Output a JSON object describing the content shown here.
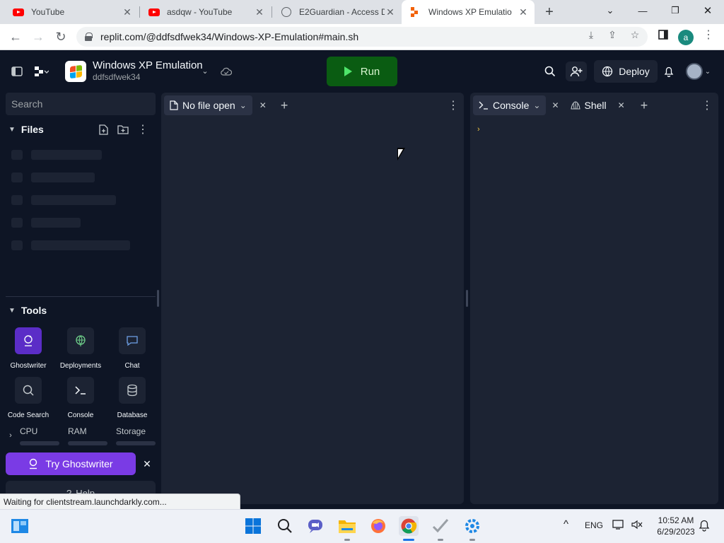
{
  "browser": {
    "tabs": [
      {
        "title": "YouTube",
        "favicon": "youtube-icon"
      },
      {
        "title": "asdqw - YouTube",
        "favicon": "youtube-icon"
      },
      {
        "title": "E2Guardian - Access D",
        "favicon": "globe-icon"
      },
      {
        "title": "Windows XP Emulatio",
        "favicon": "replit-icon",
        "active": true
      }
    ],
    "url": "replit.com/@ddfsdfwek34/Windows-XP-Emulation#main.sh",
    "profile_initial": "a",
    "status_text": "Waiting for clientstream.launchdarkly.com..."
  },
  "header": {
    "project_name": "Windows XP Emulation",
    "project_user": "ddfsdfwek34",
    "run_label": "Run",
    "deploy_label": "Deploy"
  },
  "sidebar": {
    "search_placeholder": "Search",
    "files_title": "Files",
    "tools_title": "Tools",
    "tools": [
      {
        "label": "Ghostwriter",
        "icon": "ghostwriter-icon"
      },
      {
        "label": "Deployments",
        "icon": "globe-icon"
      },
      {
        "label": "Chat",
        "icon": "chat-icon"
      },
      {
        "label": "Code Search",
        "icon": "search-icon"
      },
      {
        "label": "Console",
        "icon": "terminal-icon"
      },
      {
        "label": "Database",
        "icon": "database-icon"
      }
    ],
    "resources": [
      "CPU",
      "RAM",
      "Storage"
    ],
    "ghostwriter_cta": "Try Ghostwriter",
    "help_label": "Help"
  },
  "editor": {
    "tab_label": "No file open"
  },
  "console": {
    "tab_console": "Console",
    "tab_shell": "Shell",
    "prompt": "›"
  },
  "taskbar": {
    "language": "ENG",
    "time": "10:52 AM",
    "date": "6/29/2023"
  },
  "colors": {
    "ide_bg": "#0e1525",
    "panel_bg": "#1c2333",
    "run_green": "#0a5c12",
    "ghostwriter_purple": "#7a3be5"
  }
}
